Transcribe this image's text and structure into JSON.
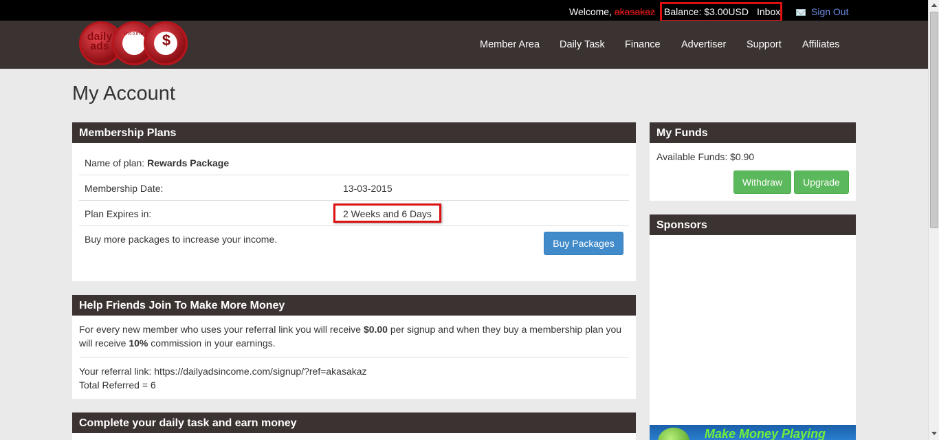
{
  "topbar": {
    "welcome": "Welcome,",
    "username": "akasakaz",
    "balance": "Balance: $3.00USD",
    "inbox": "Inbox",
    "sign_out": "Sign Out"
  },
  "logo": {
    "text1": "daily ads",
    "text2": "income",
    "text3": "$"
  },
  "nav": [
    "Member Area",
    "Daily Task",
    "Finance",
    "Advertiser",
    "Support",
    "Affiliates"
  ],
  "page_title": "My Account",
  "membership": {
    "heading": "Membership Plans",
    "plan_label": "Name of plan:",
    "plan_value": "Rewards Package",
    "date_label": "Membership Date:",
    "date_value": "13-03-2015",
    "expires_label": "Plan Expires in:",
    "expires_value": "2 Weeks and 6 Days",
    "buy_text": "Buy more packages to increase your income.",
    "buy_button": "Buy Packages"
  },
  "referral": {
    "heading": "Help Friends Join To Make More Money",
    "line1_a": "For every new member who uses your referral link you will receive",
    "line1_amount": "$0.00",
    "line1_b": "per signup and when they buy a membership plan you",
    "line2_a": "will receive",
    "line2_pct": "10%",
    "line2_b": "commission in your earnings.",
    "link_line": "Your referral link: https://dailyadsincome.com/signup/?ref=akasakaz",
    "total_line": "Total Referred = 6"
  },
  "daily_task": {
    "heading": "Complete your daily task and earn money"
  },
  "funds": {
    "heading": "My Funds",
    "available": "Available Funds: $0.90",
    "withdraw": "Withdraw",
    "upgrade": "Upgrade"
  },
  "sponsors": {
    "heading": "Sponsors",
    "ad_text": "Make Money Playing"
  }
}
